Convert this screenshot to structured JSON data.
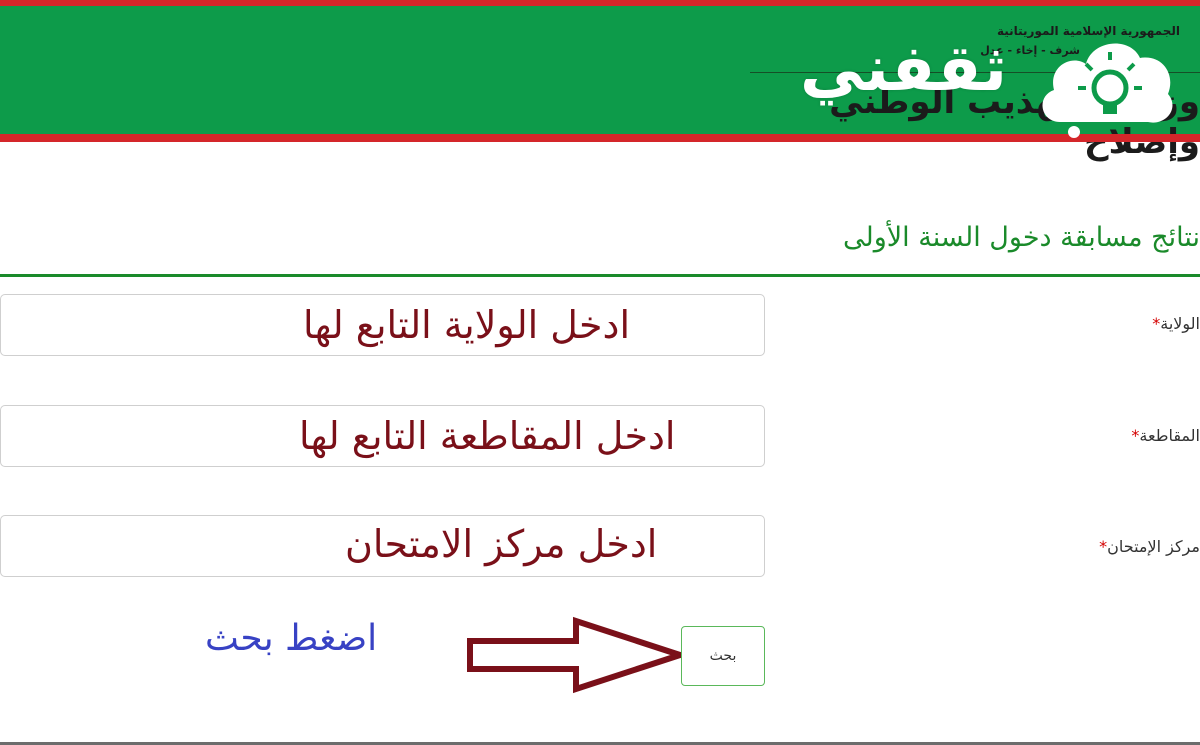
{
  "header": {
    "ministry_line1": "الجمهورية الإسلامية الموريتانية",
    "ministry_line2": "شرف - إخاء - عدل",
    "ministry_name": "وزارة التهذيب الوطني وإصلاح",
    "brand_word": "ثقفني",
    "brand_icon": "lightbulb-cloud-icon",
    "colors": {
      "green": "#0d9b4a",
      "red": "#d4262a",
      "title_green": "#1a8a2a",
      "hint_maroon": "#7a1019",
      "hint_blue": "#3842c4"
    }
  },
  "page_title": "نتائج مسابقة دخول السنة الأولى",
  "form": {
    "required_mark": "*",
    "state": {
      "label": "الولاية",
      "hint": "ادخل الولاية التابع لها"
    },
    "district": {
      "label": "المقاطعة",
      "hint": "ادخل المقاطعة التابع لها"
    },
    "center": {
      "label": "مركز الإمتحان",
      "hint": "ادخل مركز الامتحان"
    },
    "search_button": "بحث",
    "press_hint": "اضغط بحث",
    "arrow_icon": "arrow-right-icon"
  }
}
